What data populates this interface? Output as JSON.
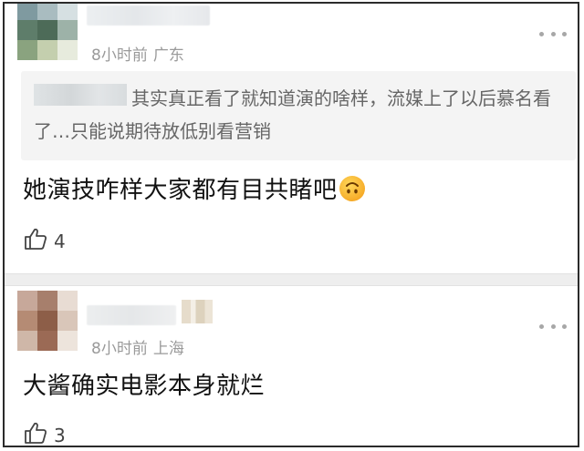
{
  "comments": [
    {
      "time": "8小时前",
      "location": "广东",
      "quote": "其实真正看了就知道演的啥样，流媒上了以后慕名看了…只能说期待放低别看营销",
      "text": "她演技咋样大家都有目共睹吧",
      "emoji": "upside-down-face",
      "likes": "4"
    },
    {
      "time": "8小时前",
      "location": "上海",
      "text": "大酱确实电影本身就烂",
      "likes": "3"
    }
  ],
  "icons": {
    "more": "more-dots-icon",
    "like": "thumbs-up-icon"
  },
  "colors": {
    "meta": "#9a9a9a",
    "quote_bg": "#f4f4f4",
    "divider": "#eeeeee",
    "text": "#111111"
  }
}
